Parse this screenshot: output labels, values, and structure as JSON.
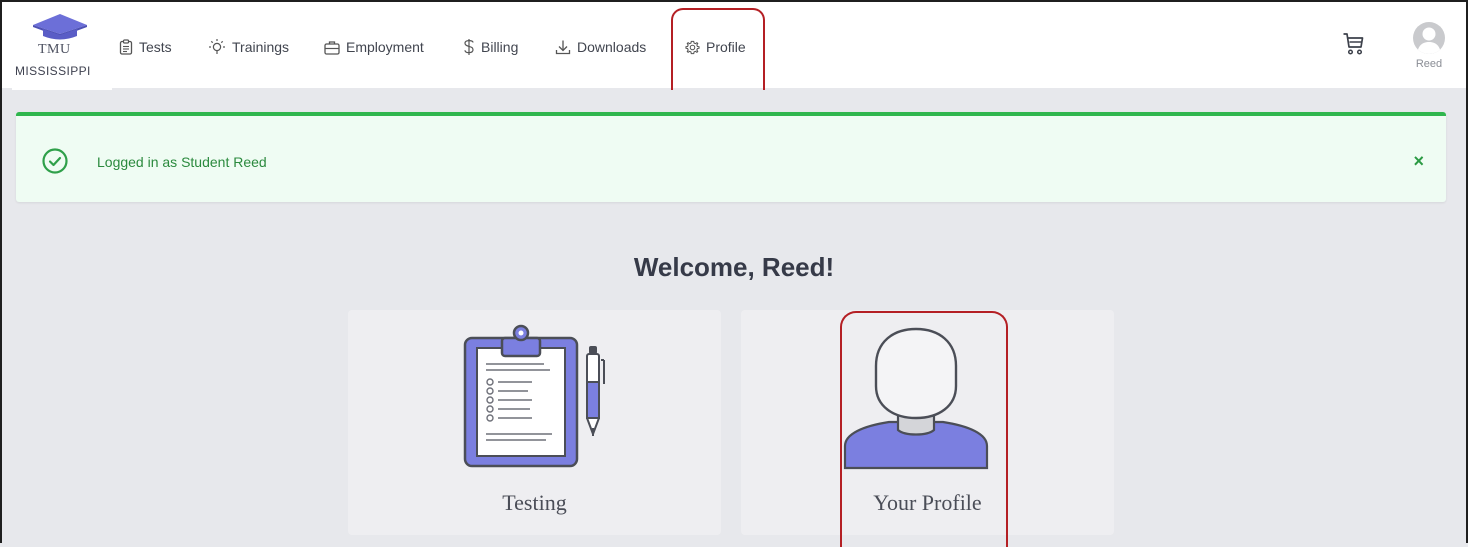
{
  "brand": {
    "abbr": "TMU",
    "state": "MISSISSIPPI"
  },
  "nav": {
    "items": [
      {
        "label": "Tests",
        "icon": "clipboard-icon"
      },
      {
        "label": "Trainings",
        "icon": "lightbulb-icon"
      },
      {
        "label": "Employment",
        "icon": "briefcase-icon"
      },
      {
        "label": "Billing",
        "icon": "dollar-icon"
      },
      {
        "label": "Downloads",
        "icon": "download-icon"
      },
      {
        "label": "Profile",
        "icon": "gear-icon"
      }
    ],
    "cart_icon": "cart-icon",
    "user_name": "Reed"
  },
  "alert": {
    "message": "Logged in as Student Reed",
    "close_label": "×",
    "color": "#2fb64d"
  },
  "main": {
    "welcome": "Welcome, Reed!",
    "cards": [
      {
        "label": "Testing",
        "icon": "clipboard-checklist-icon"
      },
      {
        "label": "Your Profile",
        "icon": "person-icon"
      }
    ]
  },
  "colors": {
    "accent": "#7b7fe0",
    "highlight": "#b41f24",
    "background": "#e7e8ec"
  }
}
